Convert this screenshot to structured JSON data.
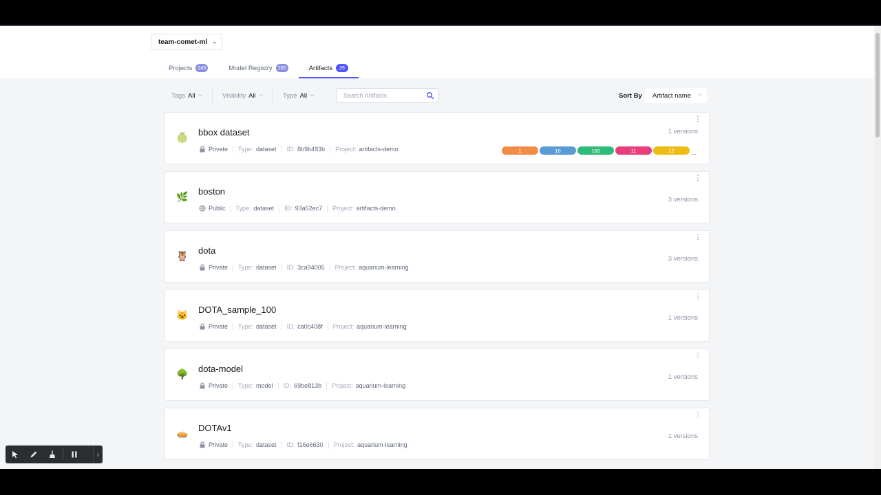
{
  "workspace": {
    "name": "team-comet-ml"
  },
  "tabs": [
    {
      "label": "Projects",
      "count": "243",
      "active": false
    },
    {
      "label": "Model Registry",
      "count": "200",
      "active": false
    },
    {
      "label": "Artifacts",
      "count": "29",
      "active": true
    }
  ],
  "filters": [
    {
      "label": "Tags",
      "value": "All"
    },
    {
      "label": "Visibility",
      "value": "All"
    },
    {
      "label": "Type",
      "value": "All"
    }
  ],
  "search": {
    "placeholder": "Search Artifacts"
  },
  "sort": {
    "label": "Sort By",
    "value": "Artifact name"
  },
  "meta_labels": {
    "type": "Type:",
    "id": "ID:",
    "project": "Project:"
  },
  "artifacts": [
    {
      "name": "bbox dataset",
      "emoji": "🍈",
      "visibility": "Private",
      "type": "dataset",
      "id": "8b9b493b",
      "project": "artifacts-demo",
      "versions": "1 versions",
      "tags": [
        {
          "label": "1",
          "color": "#f28b47"
        },
        {
          "label": "10",
          "color": "#5b9bd5"
        },
        {
          "label": "100",
          "color": "#2fbb7a"
        },
        {
          "label": "11",
          "color": "#e83e7b"
        },
        {
          "label": "12",
          "color": "#eebc14"
        }
      ],
      "tags_more": "..."
    },
    {
      "name": "boston",
      "emoji": "🌿",
      "visibility": "Public",
      "type": "dataset",
      "id": "93a52ec7",
      "project": "artifacts-demo",
      "versions": "3 versions"
    },
    {
      "name": "dota",
      "emoji": "🦉",
      "visibility": "Private",
      "type": "dataset",
      "id": "3ca94005",
      "project": "aquarium-learning",
      "versions": "3 versions"
    },
    {
      "name": "DOTA_sample_100",
      "emoji": "🐱",
      "visibility": "Private",
      "type": "dataset",
      "id": "ca0c408f",
      "project": "aquarium-learning",
      "versions": "1 versions"
    },
    {
      "name": "dota-model",
      "emoji": "🌳",
      "visibility": "Private",
      "type": "model",
      "id": "69be813b",
      "project": "aquarium-learning",
      "versions": "1 versions"
    },
    {
      "name": "DOTAv1",
      "emoji": "🥧",
      "visibility": "Private",
      "type": "dataset",
      "id": "f16e6630",
      "project": "aquarium-learning",
      "versions": "1 versions"
    }
  ],
  "colors": {
    "accent": "#5155f5",
    "badge_inactive": "#8c8fe0"
  },
  "icons": {
    "private": "lock-icon",
    "public": "globe-icon",
    "menu": "kebab-icon",
    "search": "search-icon"
  }
}
